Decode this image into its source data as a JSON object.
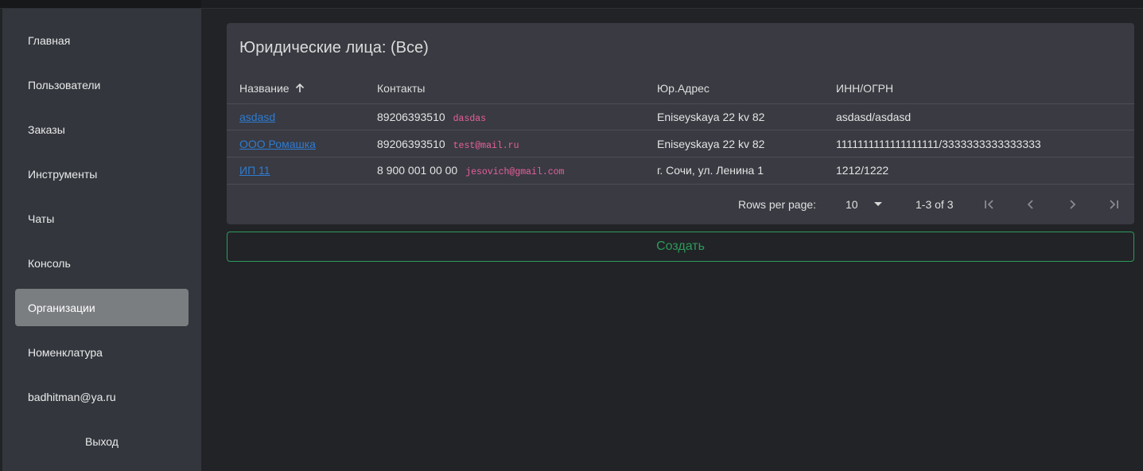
{
  "sidebar": {
    "items": [
      {
        "label": "Главная"
      },
      {
        "label": "Пользователи"
      },
      {
        "label": "Заказы"
      },
      {
        "label": "Инструменты"
      },
      {
        "label": "Чаты"
      },
      {
        "label": "Консоль"
      },
      {
        "label": "Организации"
      },
      {
        "label": "Номенклатура"
      },
      {
        "label": "badhitman@ya.ru"
      },
      {
        "label": "Выход"
      }
    ],
    "active": "Организации"
  },
  "table": {
    "title": "Юридические лица: (Все)",
    "columns": [
      "Название",
      "Контакты",
      "Юр.Адрес",
      "ИНН/ОГРН"
    ],
    "sort_icon": "arrow-up-icon",
    "rows": [
      {
        "name": "asdasd",
        "phone": "89206393510",
        "email": "dasdas",
        "address": "Eniseyskaya 22 kv 82",
        "inn_ogrn": "asdasd/asdasd"
      },
      {
        "name": "ООО Ромашка",
        "phone": "89206393510",
        "email": "test@mail.ru",
        "address": "Eniseyskaya 22 kv 82",
        "inn_ogrn": "1111111111111111111/3333333333333333"
      },
      {
        "name": "ИП 11",
        "phone": "8 900 001 00 00",
        "email": "jesovich@gmail.com",
        "address": "г. Сочи, ул. Ленина 1",
        "inn_ogrn": "1212/1222"
      }
    ],
    "pagination": {
      "rows_per_page_label": "Rows per page:",
      "rows_per_page": "10",
      "range": "1-3 of 3"
    }
  },
  "create_button": "Создать",
  "colors": {
    "background": "#212327",
    "sidebar": "#33373d",
    "card": "#393a42",
    "active_item": "#7b7e81",
    "link": "#2f7bd0",
    "email": "#e8609a",
    "accent": "#2e9a5a"
  }
}
